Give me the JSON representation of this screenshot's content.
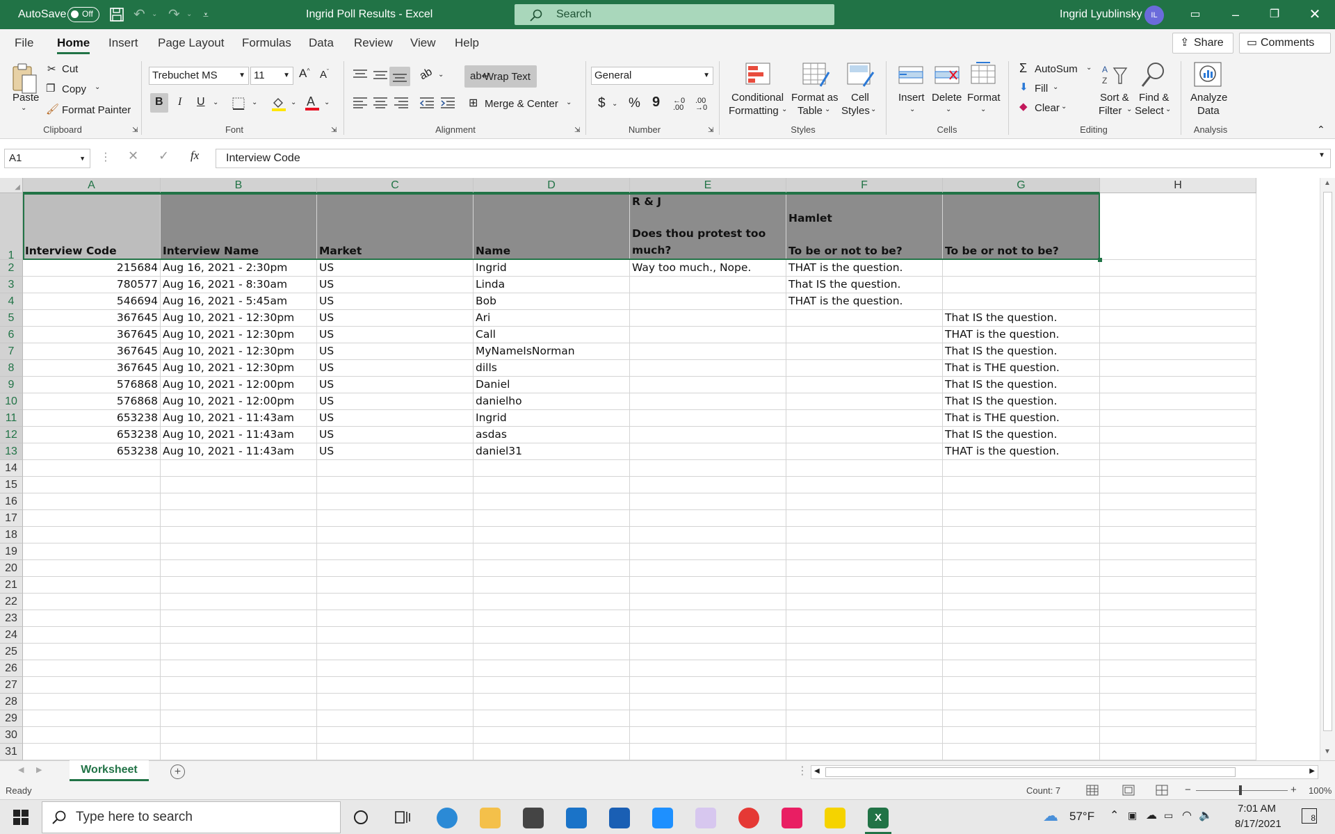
{
  "titlebar": {
    "autosave_label": "AutoSave",
    "autosave_state": "Off",
    "title": "Ingrid Poll Results  -  Excel",
    "search_placeholder": "Search",
    "user_name": "Ingrid Lyublinsky",
    "user_initials": "IL"
  },
  "menu": {
    "tabs": [
      "File",
      "Home",
      "Insert",
      "Page Layout",
      "Formulas",
      "Data",
      "Review",
      "View",
      "Help"
    ],
    "active": "Home",
    "share_label": "Share",
    "comments_label": "Comments"
  },
  "ribbon": {
    "clipboard": {
      "paste": "Paste",
      "cut": "Cut",
      "copy": "Copy",
      "format_painter": "Format Painter",
      "label": "Clipboard"
    },
    "font": {
      "family": "Trebuchet MS",
      "size": "11",
      "bold": "B",
      "italic": "I",
      "underline": "U",
      "label": "Font",
      "grow": "A^",
      "shrink": "Aˇ"
    },
    "alignment": {
      "wrap_text": "Wrap Text",
      "merge_center": "Merge & Center",
      "label": "Alignment"
    },
    "number": {
      "format": "General",
      "currency": "$",
      "percent": "%",
      "comma": "9",
      "label": "Number",
      "inc_decimal": "←0 .00",
      "dec_decimal": ".00 →0"
    },
    "styles": {
      "conditional_1": "Conditional",
      "conditional_2": "Formatting",
      "format_table_1": "Format as",
      "format_table_2": "Table",
      "cell_styles_1": "Cell",
      "cell_styles_2": "Styles",
      "label": "Styles"
    },
    "cells": {
      "insert": "Insert",
      "delete": "Delete",
      "format": "Format",
      "label": "Cells"
    },
    "editing": {
      "autosum": "AutoSum",
      "fill": "Fill",
      "clear": "Clear",
      "sort_1": "Sort &",
      "sort_2": "Filter",
      "find_1": "Find &",
      "find_2": "Select",
      "label": "Editing"
    },
    "analysis": {
      "analyze_1": "Analyze",
      "analyze_2": "Data",
      "label": "Analysis"
    }
  },
  "formula_bar": {
    "name_box": "A1",
    "fx": "fx",
    "value": "Interview Code"
  },
  "sheet": {
    "columns": [
      "A",
      "B",
      "C",
      "D",
      "E",
      "F",
      "G",
      "H"
    ],
    "header_row": {
      "A": "Interview Code",
      "B": "Interview Name",
      "C": "Market",
      "D": "Name",
      "E_line1": "R & J",
      "E_line2": "Does thou protest too much?",
      "F_line1": "Hamlet",
      "F_line2": "To be or not to be?",
      "G": "To be or not to be?"
    },
    "rows": [
      {
        "a": "215684",
        "b": "Aug 16, 2021 - 2:30pm",
        "c": "US",
        "d": "Ingrid",
        "e": "Way too much., Nope.",
        "f": "THAT is the question.",
        "g": ""
      },
      {
        "a": "780577",
        "b": "Aug 16, 2021 - 8:30am",
        "c": "US",
        "d": "Linda",
        "e": "",
        "f": "That IS the question.",
        "g": ""
      },
      {
        "a": "546694",
        "b": "Aug 16, 2021 - 5:45am",
        "c": "US",
        "d": "Bob",
        "e": "",
        "f": "THAT is the question.",
        "g": ""
      },
      {
        "a": "367645",
        "b": "Aug 10, 2021 - 12:30pm",
        "c": "US",
        "d": "Ari",
        "e": "",
        "f": "",
        "g": "That IS the question."
      },
      {
        "a": "367645",
        "b": "Aug 10, 2021 - 12:30pm",
        "c": "US",
        "d": "Call",
        "e": "",
        "f": "",
        "g": "THAT is the question."
      },
      {
        "a": "367645",
        "b": "Aug 10, 2021 - 12:30pm",
        "c": "US",
        "d": "MyNameIsNorman",
        "e": "",
        "f": "",
        "g": "That IS the question."
      },
      {
        "a": "367645",
        "b": "Aug 10, 2021 - 12:30pm",
        "c": "US",
        "d": "dills",
        "e": "",
        "f": "",
        "g": "That is THE question."
      },
      {
        "a": "576868",
        "b": "Aug 10, 2021 - 12:00pm",
        "c": "US",
        "d": "Daniel",
        "e": "",
        "f": "",
        "g": "That IS the question."
      },
      {
        "a": "576868",
        "b": "Aug 10, 2021 - 12:00pm",
        "c": "US",
        "d": "danielho",
        "e": "",
        "f": "",
        "g": "That IS the question."
      },
      {
        "a": "653238",
        "b": "Aug 10, 2021 - 11:43am",
        "c": "US",
        "d": "Ingrid",
        "e": "",
        "f": "",
        "g": "That is THE question."
      },
      {
        "a": "653238",
        "b": "Aug 10, 2021 - 11:43am",
        "c": "US",
        "d": "asdas",
        "e": "",
        "f": "",
        "g": "That IS the question."
      },
      {
        "a": "653238",
        "b": "Aug 10, 2021 - 11:43am",
        "c": "US",
        "d": "daniel31",
        "e": "",
        "f": "",
        "g": "THAT is the question."
      }
    ],
    "row_numbers": [
      "1",
      "2",
      "3",
      "4",
      "5",
      "6",
      "7",
      "8",
      "9",
      "10",
      "11",
      "12",
      "13",
      "14",
      "15",
      "16",
      "17",
      "18",
      "19",
      "20",
      "21",
      "22",
      "23",
      "24",
      "25",
      "26",
      "27",
      "28",
      "29",
      "30",
      "31"
    ],
    "tab_name": "Worksheet",
    "add_sheet": "+"
  },
  "status": {
    "ready": "Ready",
    "count": "Count: 7",
    "zoom": "100%",
    "zoom_minus": "−",
    "zoom_plus": "+"
  },
  "taskbar": {
    "search_placeholder": "Type here to search",
    "weather": "57°F",
    "time": "7:01 AM",
    "date": "8/17/2021",
    "notifications": "8"
  },
  "colors": {
    "excel_green": "#217346",
    "header_fill": "#8c8c8c"
  }
}
